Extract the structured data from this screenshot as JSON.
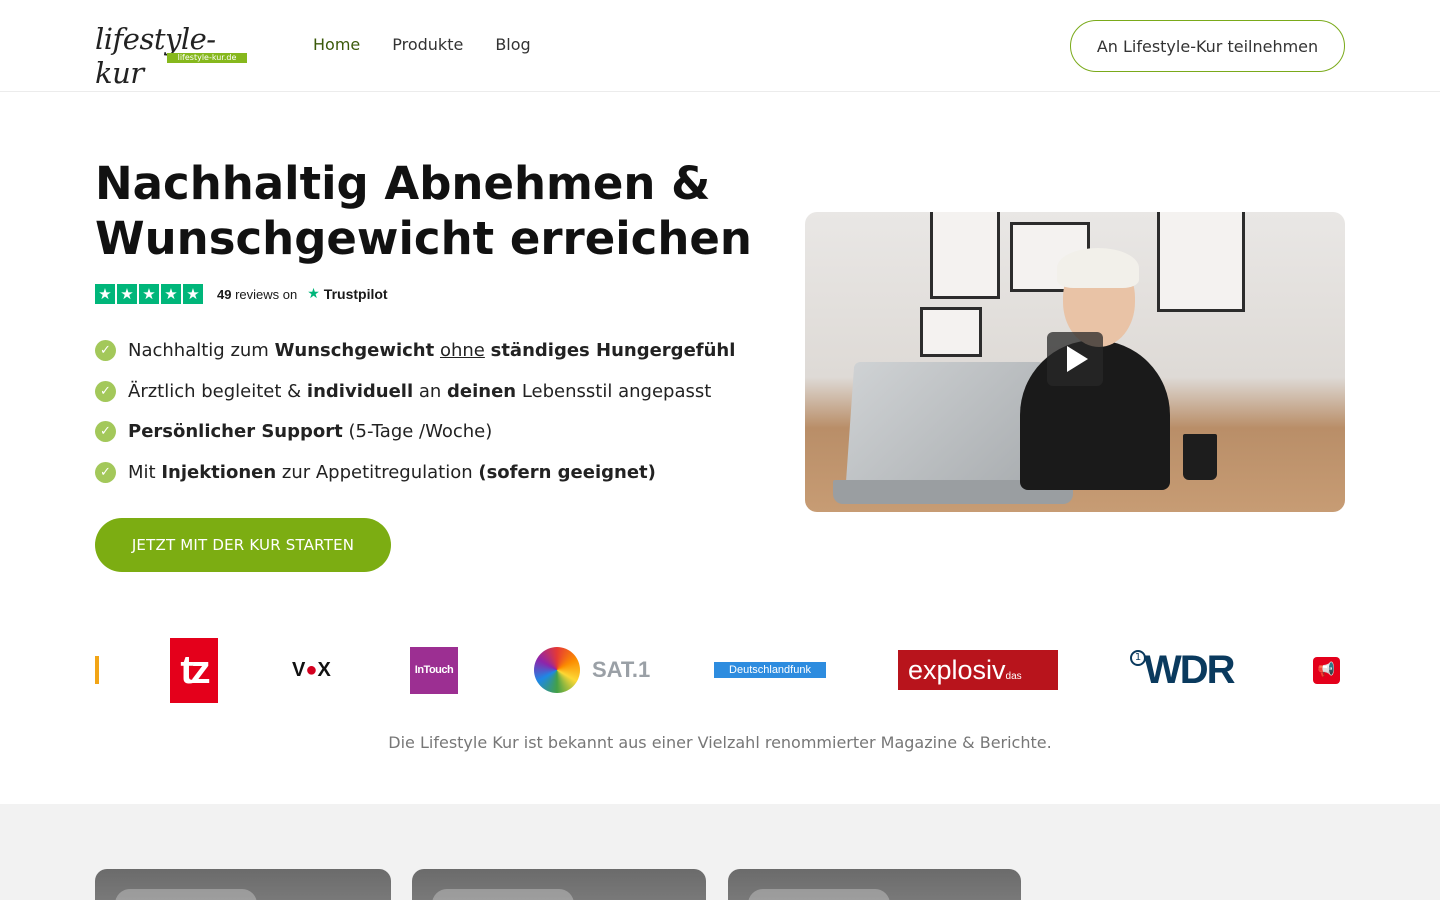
{
  "header": {
    "logo_text": "lifestyle-kur",
    "logo_sub": "lifestyle-kur.de",
    "nav": [
      {
        "label": "Home",
        "active": true
      },
      {
        "label": "Produkte",
        "active": false
      },
      {
        "label": "Blog",
        "active": false
      }
    ],
    "cta_label": "An Lifestyle-Kur teilnehmen"
  },
  "hero": {
    "title": "Nachhaltig Abnehmen & Wunschgewicht erreichen",
    "trustpilot": {
      "stars": 5,
      "count_label": "49",
      "reviews_on": "reviews on",
      "brand": "Trustpilot",
      "star_glyph": "★"
    },
    "benefits": [
      {
        "parts": [
          {
            "text": "Nachhaltig zum ",
            "style": "normal"
          },
          {
            "text": "Wunschgewicht",
            "style": "bold"
          },
          {
            "text": " ",
            "style": "normal"
          },
          {
            "text": "ohne",
            "style": "underline"
          },
          {
            "text": " ",
            "style": "normal"
          },
          {
            "text": "ständiges Hungergefühl",
            "style": "bold"
          }
        ]
      },
      {
        "parts": [
          {
            "text": "Ärztlich begleitet & ",
            "style": "normal"
          },
          {
            "text": "individuell",
            "style": "bold"
          },
          {
            "text": " an ",
            "style": "normal"
          },
          {
            "text": "deinen",
            "style": "bold"
          },
          {
            "text": " Lebensstil angepasst",
            "style": "normal"
          }
        ]
      },
      {
        "parts": [
          {
            "text": "Persönlicher Support",
            "style": "bold"
          },
          {
            "text": " (5-Tage /Woche)",
            "style": "normal"
          }
        ]
      },
      {
        "parts": [
          {
            "text": "Mit ",
            "style": "normal"
          },
          {
            "text": "Injektionen",
            "style": "bold"
          },
          {
            "text": " zur Appetitregulation ",
            "style": "normal"
          },
          {
            "text": "(sofern geeignet)",
            "style": "bold"
          }
        ]
      }
    ],
    "cta_label": "JETZT MIT DER KUR STARTEN",
    "video": {
      "play_icon": "play-icon"
    }
  },
  "press": {
    "logos": [
      {
        "name": "tz",
        "text": "tz"
      },
      {
        "name": "vox",
        "text_a": "V",
        "text_o": "●",
        "text_b": "X"
      },
      {
        "name": "intouch",
        "text": "InTouch"
      },
      {
        "name": "sat1",
        "text": "SAT.1"
      },
      {
        "name": "deutschlandfunk",
        "text": "Deutschlandfunk"
      },
      {
        "name": "explosiv",
        "text": "explosiv",
        "small": "das magazin"
      },
      {
        "name": "wdr",
        "text": "WDR",
        "prefix": "1"
      }
    ],
    "note": "Die Lifestyle Kur ist bekannt aus einer Vielzahl renommierter Magazine & Berichte."
  },
  "colors": {
    "accent": "#7cad12",
    "trustpilot": "#00b67a",
    "check": "#a3c85a"
  }
}
